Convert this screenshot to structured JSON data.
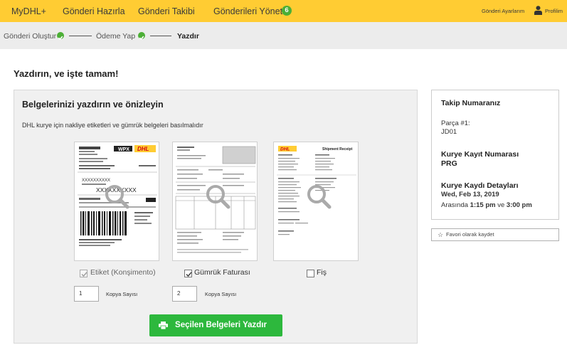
{
  "nav": {
    "brand": "MyDHL+",
    "items": [
      "Gönderi Hazırla",
      "Gönderi Takibi",
      "Gönderileri Yönet"
    ],
    "badge": "6",
    "settings": "Gönderi Ayarlarım",
    "profile": "Profilim"
  },
  "steps": [
    {
      "label": "Gönderi Oluştur",
      "done": true
    },
    {
      "label": "Ödeme Yap",
      "done": true
    },
    {
      "label": "Yazdır",
      "done": false
    }
  ],
  "page": {
    "heading": "Yazdırın, ve işte tamam!"
  },
  "panel": {
    "title": "Belgelerinizi yazdırın ve önizleyin",
    "subtitle": "DHL kurye için nakliye etiketleri ve gümrük belgeleri basılmalıdır",
    "copies_label": "Kopya Sayısı",
    "print_button": "Seçilen Belgeleri Yazdır",
    "docs": [
      {
        "label": "Etiket (Konşimento)",
        "checked": true,
        "disabled": true,
        "copies": "1"
      },
      {
        "label": "Gümrük Faturası",
        "checked": true,
        "disabled": false,
        "copies": "2"
      },
      {
        "label": "Fiş",
        "checked": false,
        "disabled": false
      }
    ],
    "label_preview": {
      "product": "WPX",
      "brand": "DHL",
      "placeholder": "XXXXXXXXXX"
    },
    "receipt_preview": {
      "title": "Shipment Receipt"
    }
  },
  "tracking": {
    "title": "Takip Numaranız",
    "piece_label": "Parça #1:",
    "piece_value": "JD01",
    "pickup_title": "Kurye Kayıt Numarası",
    "pickup_value": "PRG",
    "details_title": "Kurye Kaydı Detayları",
    "date": "Wed, Feb 13, 2019",
    "range_prefix": "Arasında",
    "time_from": "1:15 pm",
    "range_mid": "ve",
    "time_to": "3:00 pm"
  },
  "favorite": {
    "label": "Favori olarak kaydet"
  },
  "colors": {
    "dhl_yellow": "#ffcc33",
    "dhl_red": "#d40511",
    "success_green": "#2db83d",
    "badge_green": "#4caf36"
  }
}
